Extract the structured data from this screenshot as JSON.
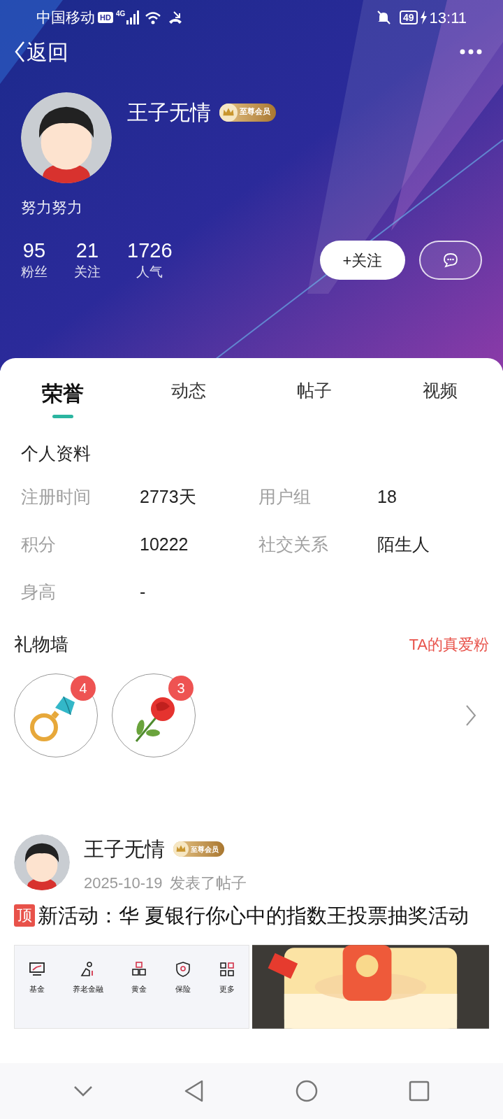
{
  "status_bar": {
    "carrier": "中国移动",
    "hd": "HD",
    "network": "4G",
    "battery": "49",
    "time": "13:11"
  },
  "nav": {
    "back": "返回"
  },
  "profile": {
    "name": "王子无情",
    "vip_badge": "至尊会员",
    "bio": "努力努力",
    "stats": [
      {
        "value": "95",
        "label": "粉丝"
      },
      {
        "value": "21",
        "label": "关注"
      },
      {
        "value": "1726",
        "label": "人气"
      }
    ],
    "follow_button": "+关注"
  },
  "tabs": [
    {
      "label": "荣誉",
      "selected": true
    },
    {
      "label": "动态",
      "selected": false
    },
    {
      "label": "帖子",
      "selected": false
    },
    {
      "label": "视频",
      "selected": false
    }
  ],
  "personal_info": {
    "title": "个人资料",
    "fields": [
      {
        "label": "注册时间",
        "value": "2773天"
      },
      {
        "label": "用户组",
        "value": "18"
      },
      {
        "label": "积分",
        "value": "10222"
      },
      {
        "label": "社交关系",
        "value": "陌生人"
      },
      {
        "label": "身高",
        "value": "-"
      }
    ]
  },
  "gift_wall": {
    "title": "礼物墙",
    "link": "TA的真爱粉",
    "gifts": [
      {
        "kind": "ring",
        "count": "4"
      },
      {
        "kind": "rose",
        "count": "3"
      }
    ]
  },
  "post": {
    "author": "王子无情",
    "vip_badge": "至尊会员",
    "date": "2025-10-19",
    "action": "发表了帖子",
    "pin": "顶",
    "title": "新活动：华 夏银行你心中的指数王投票抽奖活动",
    "image_menu": [
      "基金",
      "养老金融",
      "黄金",
      "保险",
      "更多"
    ]
  }
}
